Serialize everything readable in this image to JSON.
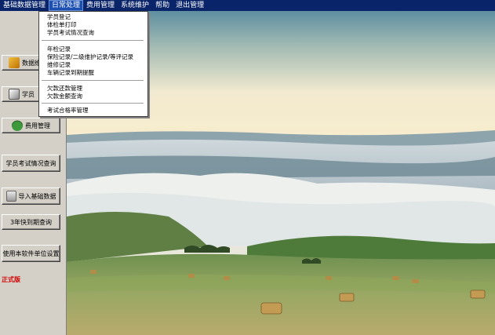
{
  "menubar": {
    "items": [
      "基础数据管理",
      "日常处理",
      "费用管理",
      "系统维护",
      "帮助",
      "退出管理"
    ],
    "active_index": 1
  },
  "dropdown": {
    "groups": [
      [
        "学员登记",
        "体检单打印",
        "学员考试情况查询"
      ],
      [
        "年检记录",
        "保险记录/二级维护记录/等评记录",
        "维修记录",
        "车辆记录到期提醒"
      ],
      [
        "欠款还款管理",
        "欠款金额查询"
      ],
      [
        "考试合格率管理"
      ]
    ]
  },
  "sidebar": {
    "buttons": [
      "数据维护",
      "学员",
      "费用管理",
      "学员考试情况查询",
      "导入基础数据",
      "3年快到期查询",
      "使用本软件单位设置"
    ],
    "version_label": "正式版"
  },
  "colors": {
    "menubar_bg": "#0a246a",
    "window_bg": "#d4d0c8",
    "version_label": "#d40000"
  },
  "icons": [
    "data-icon",
    "pen-icon",
    "money-bag-icon",
    "import-icon"
  ]
}
